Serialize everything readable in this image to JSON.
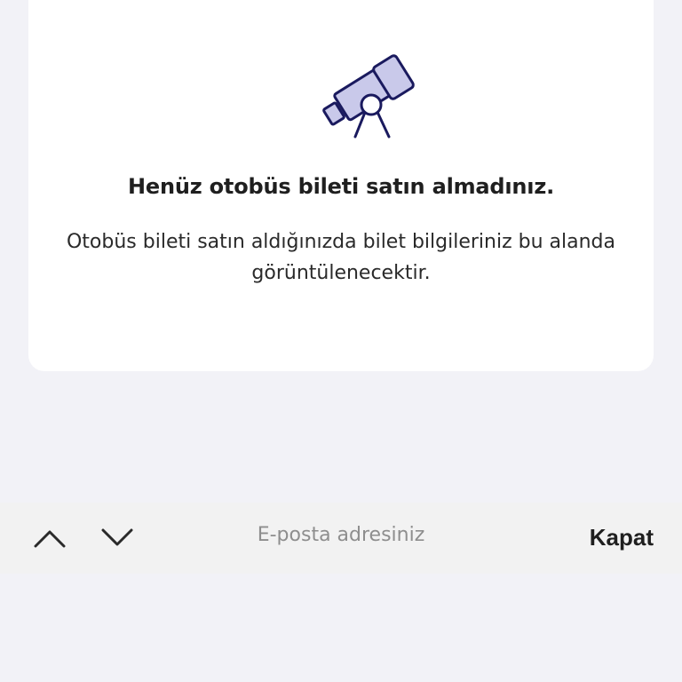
{
  "empty_state": {
    "icon": "telescope-icon",
    "title": "Henüz otobüs bileti satın almadınız.",
    "description": "Otobüs bileti satın aldığınızda bilet bilgileriniz bu alanda görüntülenecektir."
  },
  "keyboard_toolbar": {
    "previous_icon": "chevron-up-icon",
    "next_icon": "chevron-down-icon",
    "field_label": "E-posta adresiniz",
    "close_label": "Kapat"
  },
  "colors": {
    "background": "#f2f2f7",
    "card": "#ffffff",
    "icon_stroke": "#1a1a5e",
    "icon_fill": "#c9c9ea",
    "title": "#1f1f1f",
    "toolbar": "#f2f2f2",
    "placeholder": "#8e8e8e"
  }
}
